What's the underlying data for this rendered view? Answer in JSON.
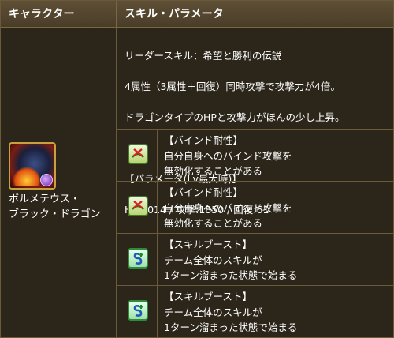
{
  "header": {
    "col1": "キャラクター",
    "col2": "スキル・パラメータ"
  },
  "character": {
    "name_line1": "ボルメテウス・",
    "name_line2": "ブラック・ドラゴン"
  },
  "skill": {
    "leader_line": "リーダースキル：希望と勝利の伝説",
    "line2": "4属性（3属性＋回復）同時攻撃で攻撃力が4倍。",
    "line3": "ドラゴンタイプのHPと攻撃力がほんの少し上昇。",
    "param_title": "【パラメータ(Lv最大時)】",
    "param_values": "HP:4014 / 攻撃:1850 / 回復:61"
  },
  "awakenings": [
    {
      "icon": "bind-resist-icon",
      "title": "【バインド耐性】",
      "line1": "自分自身へのバインド攻撃を",
      "line2": "無効化することがある"
    },
    {
      "icon": "bind-resist-icon",
      "title": "【バインド耐性】",
      "line1": "自分自身へのバインド攻撃を",
      "line2": "無効化することがある"
    },
    {
      "icon": "skill-boost-icon",
      "title": "【スキルブースト】",
      "line1": "チーム全体のスキルが",
      "line2": "1ターン溜まった状態で始まる"
    },
    {
      "icon": "skill-boost-icon",
      "title": "【スキルブースト】",
      "line1": "チーム全体のスキルが",
      "line2": "1ターン溜まった状態で始まる"
    }
  ]
}
